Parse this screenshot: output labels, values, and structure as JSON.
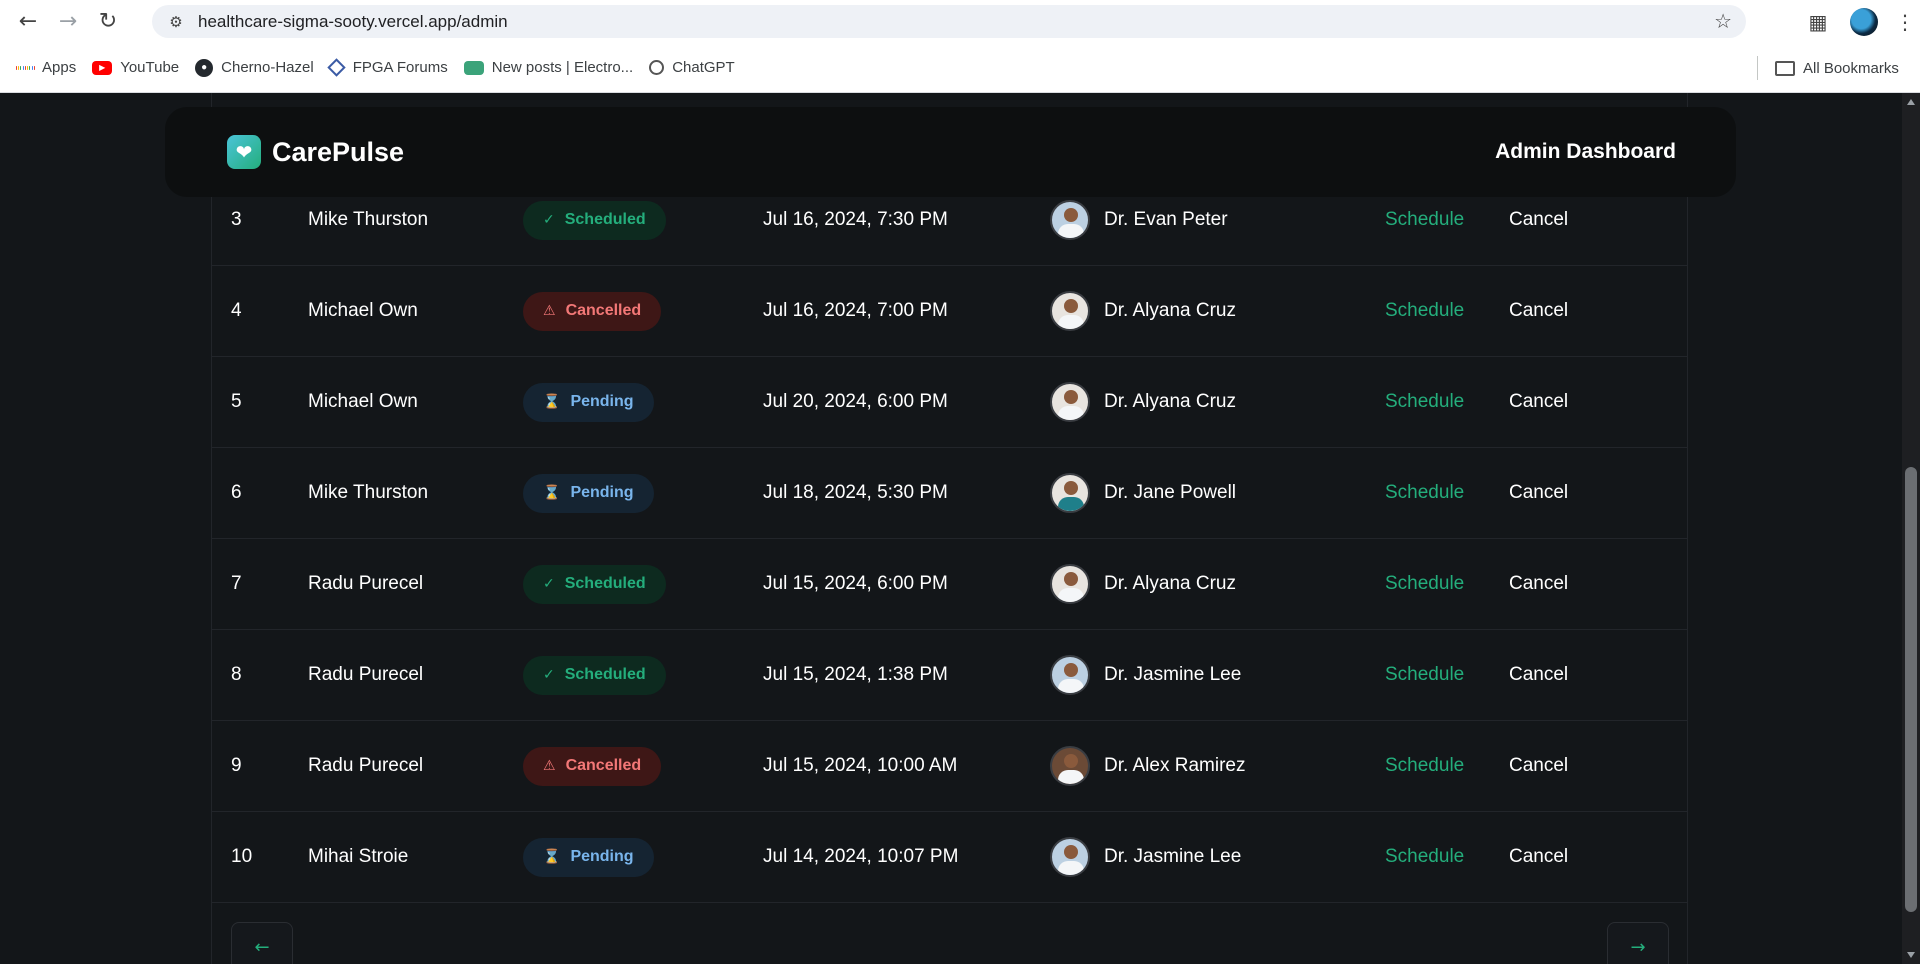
{
  "browser": {
    "url": "healthcare-sigma-sooty.vercel.app/admin",
    "bookmarks": [
      {
        "label": "Apps",
        "icon": "apps-grid-icon"
      },
      {
        "label": "YouTube",
        "icon": "youtube-icon"
      },
      {
        "label": "Cherno-Hazel",
        "icon": "github-icon"
      },
      {
        "label": "FPGA Forums",
        "icon": "fpga-diamond-icon"
      },
      {
        "label": "New posts | Electro...",
        "icon": "robot-icon"
      },
      {
        "label": "ChatGPT",
        "icon": "chatgpt-icon"
      }
    ],
    "all_bookmarks": "All Bookmarks"
  },
  "header": {
    "logo": "CarePulse",
    "title": "Admin Dashboard"
  },
  "appointments": [
    {
      "num": "3",
      "patient": "Mike Thurston",
      "status": "Scheduled",
      "date": "Jul 16, 2024, 7:30 PM",
      "doctor": "Dr. Evan Peter",
      "schedule": "Schedule",
      "cancel": "Cancel"
    },
    {
      "num": "4",
      "patient": "Michael Own",
      "status": "Cancelled",
      "date": "Jul 16, 2024, 7:00 PM",
      "doctor": "Dr. Alyana Cruz",
      "schedule": "Schedule",
      "cancel": "Cancel"
    },
    {
      "num": "5",
      "patient": "Michael Own",
      "status": "Pending",
      "date": "Jul 20, 2024, 6:00 PM",
      "doctor": "Dr. Alyana Cruz",
      "schedule": "Schedule",
      "cancel": "Cancel"
    },
    {
      "num": "6",
      "patient": "Mike Thurston",
      "status": "Pending",
      "date": "Jul 18, 2024, 5:30 PM",
      "doctor": "Dr. Jane Powell",
      "schedule": "Schedule",
      "cancel": "Cancel"
    },
    {
      "num": "7",
      "patient": "Radu Purecel",
      "status": "Scheduled",
      "date": "Jul 15, 2024, 6:00 PM",
      "doctor": "Dr. Alyana Cruz",
      "schedule": "Schedule",
      "cancel": "Cancel"
    },
    {
      "num": "8",
      "patient": "Radu Purecel",
      "status": "Scheduled",
      "date": "Jul 15, 2024, 1:38 PM",
      "doctor": "Dr. Jasmine Lee",
      "schedule": "Schedule",
      "cancel": "Cancel"
    },
    {
      "num": "9",
      "patient": "Radu Purecel",
      "status": "Cancelled",
      "date": "Jul 15, 2024, 10:00 AM",
      "doctor": "Dr. Alex Ramirez",
      "schedule": "Schedule",
      "cancel": "Cancel"
    },
    {
      "num": "10",
      "patient": "Mihai Stroie",
      "status": "Pending",
      "date": "Jul 14, 2024, 10:07 PM",
      "doctor": "Dr. Jasmine Lee",
      "schedule": "Schedule",
      "cancel": "Cancel"
    }
  ],
  "pagination": {
    "prev_icon": "arrow-left-icon",
    "next_icon": "arrow-right-icon"
  },
  "colors": {
    "accent_green": "#24ae7c",
    "cancelled_red": "#f37877",
    "pending_blue": "#79b5ec",
    "background": "#131619"
  }
}
